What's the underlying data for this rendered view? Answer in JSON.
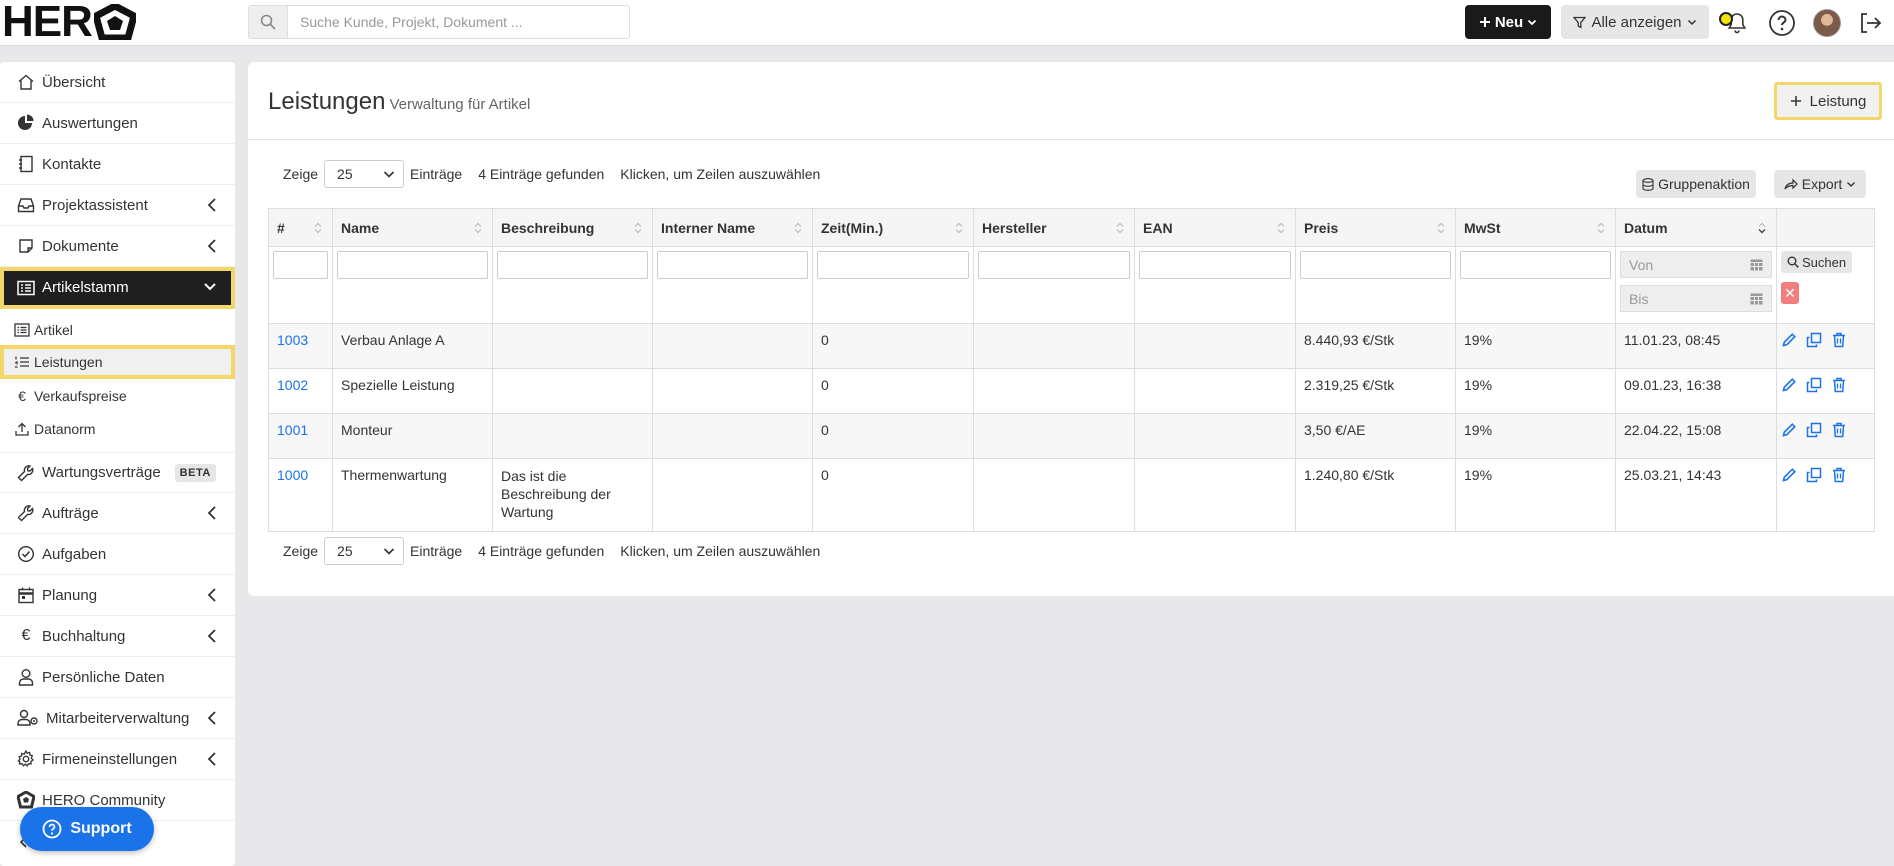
{
  "app": {
    "logo_text": "HER"
  },
  "search": {
    "placeholder": "Suche Kunde, Projekt, Dokument ..."
  },
  "header": {
    "new_label": "Neu",
    "filter_label": "Alle anzeigen"
  },
  "sidebar": {
    "items": [
      {
        "label": "Übersicht"
      },
      {
        "label": "Auswertungen"
      },
      {
        "label": "Kontakte"
      },
      {
        "label": "Projektassistent"
      },
      {
        "label": "Dokumente"
      },
      {
        "label": "Artikelstamm"
      },
      {
        "label": "Wartungsverträge",
        "badge": "BETA"
      },
      {
        "label": "Aufträge"
      },
      {
        "label": "Aufgaben"
      },
      {
        "label": "Planung"
      },
      {
        "label": "Buchhaltung"
      },
      {
        "label": "Persönliche Daten"
      },
      {
        "label": "Mitarbeiterverwaltung"
      },
      {
        "label": "Firmeneinstellungen"
      },
      {
        "label": "HERO Community"
      }
    ],
    "subitems": [
      {
        "label": "Artikel"
      },
      {
        "label": "Leistungen"
      },
      {
        "label": "Verkaufspreise"
      },
      {
        "label": "Datanorm"
      }
    ],
    "support_label": "Support"
  },
  "page": {
    "title": "Leistungen",
    "subtitle": "Verwaltung für Artikel",
    "add_button": "Leistung"
  },
  "controls": {
    "show_label": "Zeige",
    "page_size": "25",
    "entries_label": "Einträge",
    "found": "4 Einträge gefunden",
    "hint": "Klicken, um Zeilen auszuwählen",
    "group_action": "Gruppenaktion",
    "export": "Export"
  },
  "table": {
    "columns": [
      "#",
      "Name",
      "Beschreibung",
      "Interner Name",
      "Zeit(Min.)",
      "Hersteller",
      "EAN",
      "Preis",
      "MwSt",
      "Datum"
    ],
    "filters": {
      "von_placeholder": "Von",
      "bis_placeholder": "Bis",
      "search_label": "Suchen",
      "clear_label": "✕"
    },
    "rows": [
      {
        "id": "1003",
        "name": "Verbau Anlage A",
        "desc": "",
        "internal": "",
        "time": "0",
        "maker": "",
        "ean": "",
        "price": "8.440,93 €/Stk",
        "vat": "19%",
        "date": "11.01.23, 08:45"
      },
      {
        "id": "1002",
        "name": "Spezielle Leistung",
        "desc": "",
        "internal": "",
        "time": "0",
        "maker": "",
        "ean": "",
        "price": "2.319,25 €/Stk",
        "vat": "19%",
        "date": "09.01.23, 16:38"
      },
      {
        "id": "1001",
        "name": "Monteur",
        "desc": "",
        "internal": "",
        "time": "0",
        "maker": "",
        "ean": "",
        "price": "3,50 €/AE",
        "vat": "19%",
        "date": "22.04.22, 15:08"
      },
      {
        "id": "1000",
        "name": "Thermenwartung",
        "desc": "Das ist die Beschreibung der Wartung",
        "internal": "",
        "time": "0",
        "maker": "",
        "ean": "",
        "price": "1.240,80 €/Stk",
        "vat": "19%",
        "date": "25.03.21, 14:43"
      }
    ]
  },
  "colors": {
    "accent": "#1a73e8",
    "highlight": "#f4d76a",
    "dark": "#1f1f1f",
    "danger": "#f08080"
  }
}
